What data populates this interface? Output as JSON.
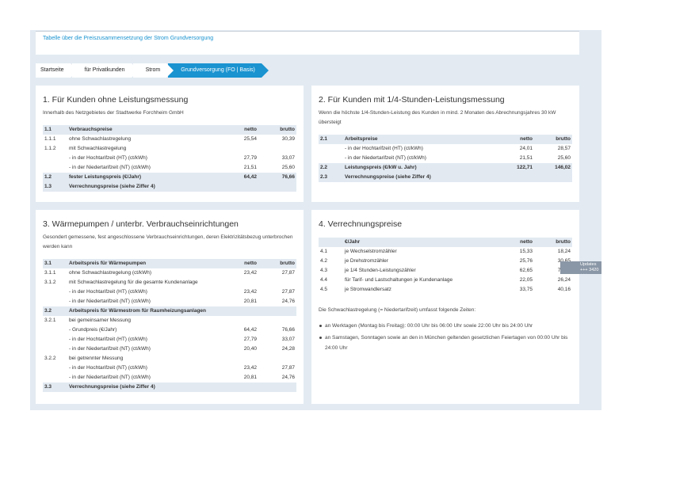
{
  "header": {
    "link_text": "Tabelle über die Preiszusammensetzung der Strom Grundversorgung"
  },
  "breadcrumb": [
    "Startseite",
    "für Privatkunden",
    "Strom",
    "Grundversorgung (FO | Basis)"
  ],
  "panel1": {
    "title": "1. Für Kunden ohne Leistungsmessung",
    "subtitle": "Innerhalb des Netzgebietes der Stadtwerke Forchheim GmbH",
    "rows": [
      {
        "nr": "1.1",
        "label": "Verbrauchspreise",
        "netto": "netto",
        "brutto": "brutto",
        "hl": true,
        "bold": true
      },
      {
        "nr": "1.1.1",
        "label": "ohne Schwachlastregelung",
        "netto": "25,54",
        "brutto": "30,39"
      },
      {
        "nr": "1.1.2",
        "label": "mit Schwachlastregelung",
        "netto": "",
        "brutto": ""
      },
      {
        "nr": "",
        "label": "- in der Hochtarifzeit (HT) (ct/kWh)",
        "netto": "27,79",
        "brutto": "33,07"
      },
      {
        "nr": "",
        "label": "- in der Niedertarifzeit (NT) (ct/kWh)",
        "netto": "21,51",
        "brutto": "25,60"
      },
      {
        "nr": "1.2",
        "label": "fester Leistungspreis (€/Jahr)",
        "netto": "64,42",
        "brutto": "76,66",
        "hl": true,
        "bold": true
      },
      {
        "nr": "1.3",
        "label": "Verrechnungspreise (siehe Ziffer 4)",
        "netto": "",
        "brutto": "",
        "hl": true,
        "bold": true
      }
    ]
  },
  "panel2": {
    "title": "2. Für Kunden mit 1/4-Stunden-Leistungsmessung",
    "subtitle": "Wenn die höchste 1/4-Stunden-Leistung des Kunden in mind. 2 Monaten des Abrechnungsjahres 30 kW übersteigt",
    "rows": [
      {
        "nr": "2.1",
        "label": "Arbeitspreise",
        "netto": "netto",
        "brutto": "brutto",
        "hl": true,
        "bold": true
      },
      {
        "nr": "",
        "label": "- in der Hochtarifzeit (HT) (ct/kWh)",
        "netto": "24,01",
        "brutto": "28,57"
      },
      {
        "nr": "",
        "label": "- in der Niedertarifzeit (NT) (ct/kWh)",
        "netto": "21,51",
        "brutto": "25,60"
      },
      {
        "nr": "2.2",
        "label": "Leistungspreis (€/kW u. Jahr)",
        "netto": "122,71",
        "brutto": "146,02",
        "hl": true,
        "bold": true
      },
      {
        "nr": "2.3",
        "label": "Verrechnungspreise (siehe Ziffer 4)",
        "netto": "",
        "brutto": "",
        "hl": true,
        "bold": true
      }
    ]
  },
  "panel3": {
    "title": "3. Wärmepumpen / unterbr. Verbrauchseinrichtungen",
    "subtitle": "Gesondert gemessene, fest angeschlossene Verbrauchseinrichtungen, deren Elektrizitätsbezug unterbrochen werden kann",
    "rows": [
      {
        "nr": "3.1",
        "label": "Arbeitspreis für Wärmepumpen",
        "netto": "netto",
        "brutto": "brutto",
        "hl": true,
        "bold": true
      },
      {
        "nr": "3.1.1",
        "label": "ohne Schwachlastregelung (ct/kWh)",
        "netto": "23,42",
        "brutto": "27,87"
      },
      {
        "nr": "3.1.2",
        "label": "mit Schwachlastregelung für die gesamte Kundenanlage",
        "netto": "",
        "brutto": ""
      },
      {
        "nr": "",
        "label": "- in der Hochtarifzeit (HT) (ct/kWh)",
        "netto": "23,42",
        "brutto": "27,87"
      },
      {
        "nr": "",
        "label": "- in der Niedertarifzeit (NT) (ct/kWh)",
        "netto": "20,81",
        "brutto": "24,76"
      },
      {
        "nr": "3.2",
        "label": "Arbeitspreis für Wärmestrom für Raumheizungsanlagen",
        "netto": "",
        "brutto": "",
        "hl": true,
        "bold": true
      },
      {
        "nr": "3.2.1",
        "label": "bei gemeinsamer Messung",
        "netto": "",
        "brutto": ""
      },
      {
        "nr": "",
        "label": "- Grundpreis (€/Jahr)",
        "netto": "64,42",
        "brutto": "76,66"
      },
      {
        "nr": "",
        "label": "- in der Hochtarifzeit (HT) (ct/kWh)",
        "netto": "27,79",
        "brutto": "33,07"
      },
      {
        "nr": "",
        "label": "- in der Niedertarifzeit (NT) (ct/kWh)",
        "netto": "20,40",
        "brutto": "24,28"
      },
      {
        "nr": "3.2.2",
        "label": "bei getrennter Messung",
        "netto": "",
        "brutto": ""
      },
      {
        "nr": "",
        "label": "- in der Hochtarifzeit (NT) (ct/kWh)",
        "netto": "23,42",
        "brutto": "27,87"
      },
      {
        "nr": "",
        "label": "- in der Niedertarifzeit (NT) (ct/kWh)",
        "netto": "20,81",
        "brutto": "24,76"
      },
      {
        "nr": "3.3",
        "label": "Verrechnungspreise (siehe Ziffer 4)",
        "netto": "",
        "brutto": "",
        "hl": true,
        "bold": true
      }
    ]
  },
  "panel4": {
    "title": "4. Verrechnungspreise",
    "rows": [
      {
        "nr": "",
        "label": "€/Jahr",
        "netto": "netto",
        "brutto": "brutto",
        "hl": true,
        "bold": true
      },
      {
        "nr": "4.1",
        "label": "je Wechselstromzähler",
        "netto": "15,33",
        "brutto": "18,24"
      },
      {
        "nr": "4.2",
        "label": "je Drehstromzähler",
        "netto": "25,76",
        "brutto": "30,65"
      },
      {
        "nr": "4.3",
        "label": "je 1/4 Stunden-Leistungszähler",
        "netto": "62,65",
        "brutto": "74,55"
      },
      {
        "nr": "4.4",
        "label": "für Tarif- und Lastschaltungen je Kundenanlage",
        "netto": "22,05",
        "brutto": "26,24"
      },
      {
        "nr": "4.5",
        "label": "je Stromwandlersatz",
        "netto": "33,75",
        "brutto": "40,16"
      }
    ],
    "note": "Die Schwachlastregelung (= Niedertarifzeit) umfasst folgende Zeiten:",
    "bullets": [
      "an Werktagen (Montag bis Freitag): 00:00 Uhr bis 06:00 Uhr sowie 22:00 Uhr bis 24:00 Uhr",
      "an Samstagen, Sonntagen sowie an den in München geltenden gesetzlichen Feiertagen von 00:00 Uhr bis 24:00 Uhr"
    ]
  },
  "tooltip": {
    "line1": "Updates",
    "line2": "+++ 3420 +++"
  }
}
